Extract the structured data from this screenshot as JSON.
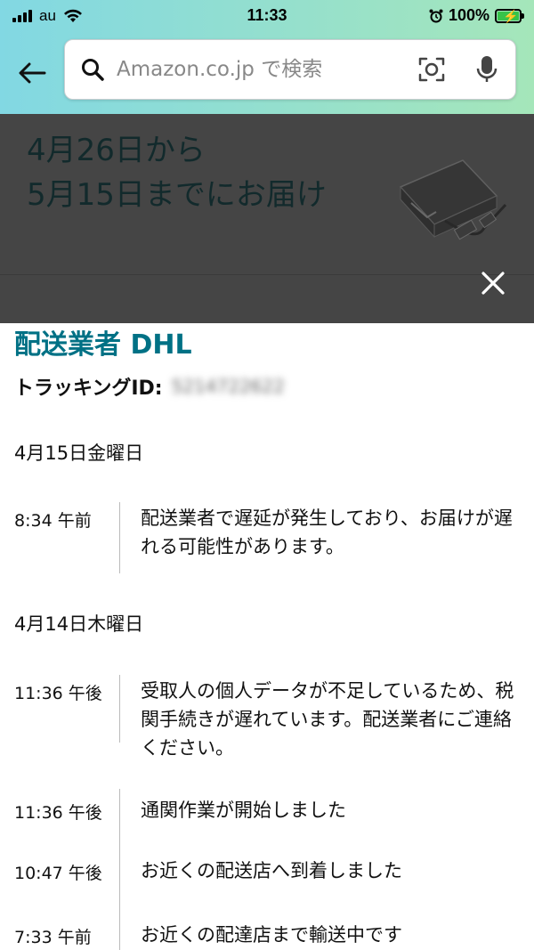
{
  "status_bar": {
    "carrier": "au",
    "time": "11:33",
    "battery": "100%"
  },
  "search": {
    "placeholder": "Amazon.co.jp で検索"
  },
  "overlay": {
    "delivery_date_text": "4月26日から\n5月15日までにお届け"
  },
  "shipment": {
    "carrier_heading": "配送業者 DHL",
    "tracking_label": "トラッキングID:",
    "tracking_id": "5214722622"
  },
  "days": [
    {
      "date": "4月15日金曜日",
      "events": [
        {
          "time": "8:34 午前",
          "text": "配送業者で遅延が発生しており、お届けが遅れる可能性があります。"
        }
      ]
    },
    {
      "date": "4月14日木曜日",
      "events": [
        {
          "time": "11:36 午後",
          "text": "受取人の個人データが不足しているため、税関手続きが遅れています。配送業者にご連絡ください。"
        },
        {
          "time": "11:36 午後",
          "text": "通関作業が開始しました"
        },
        {
          "time": "10:47 午後",
          "text": "お近くの配送店へ到着しました"
        },
        {
          "time": "7:33 午前",
          "text": "お近くの配達店まで輸送中です"
        }
      ]
    }
  ],
  "colors": {
    "accent": "#007185",
    "header_gradient_start": "#82d8e3",
    "header_gradient_end": "#a5e6ba",
    "overlay_bg": "#454545"
  }
}
